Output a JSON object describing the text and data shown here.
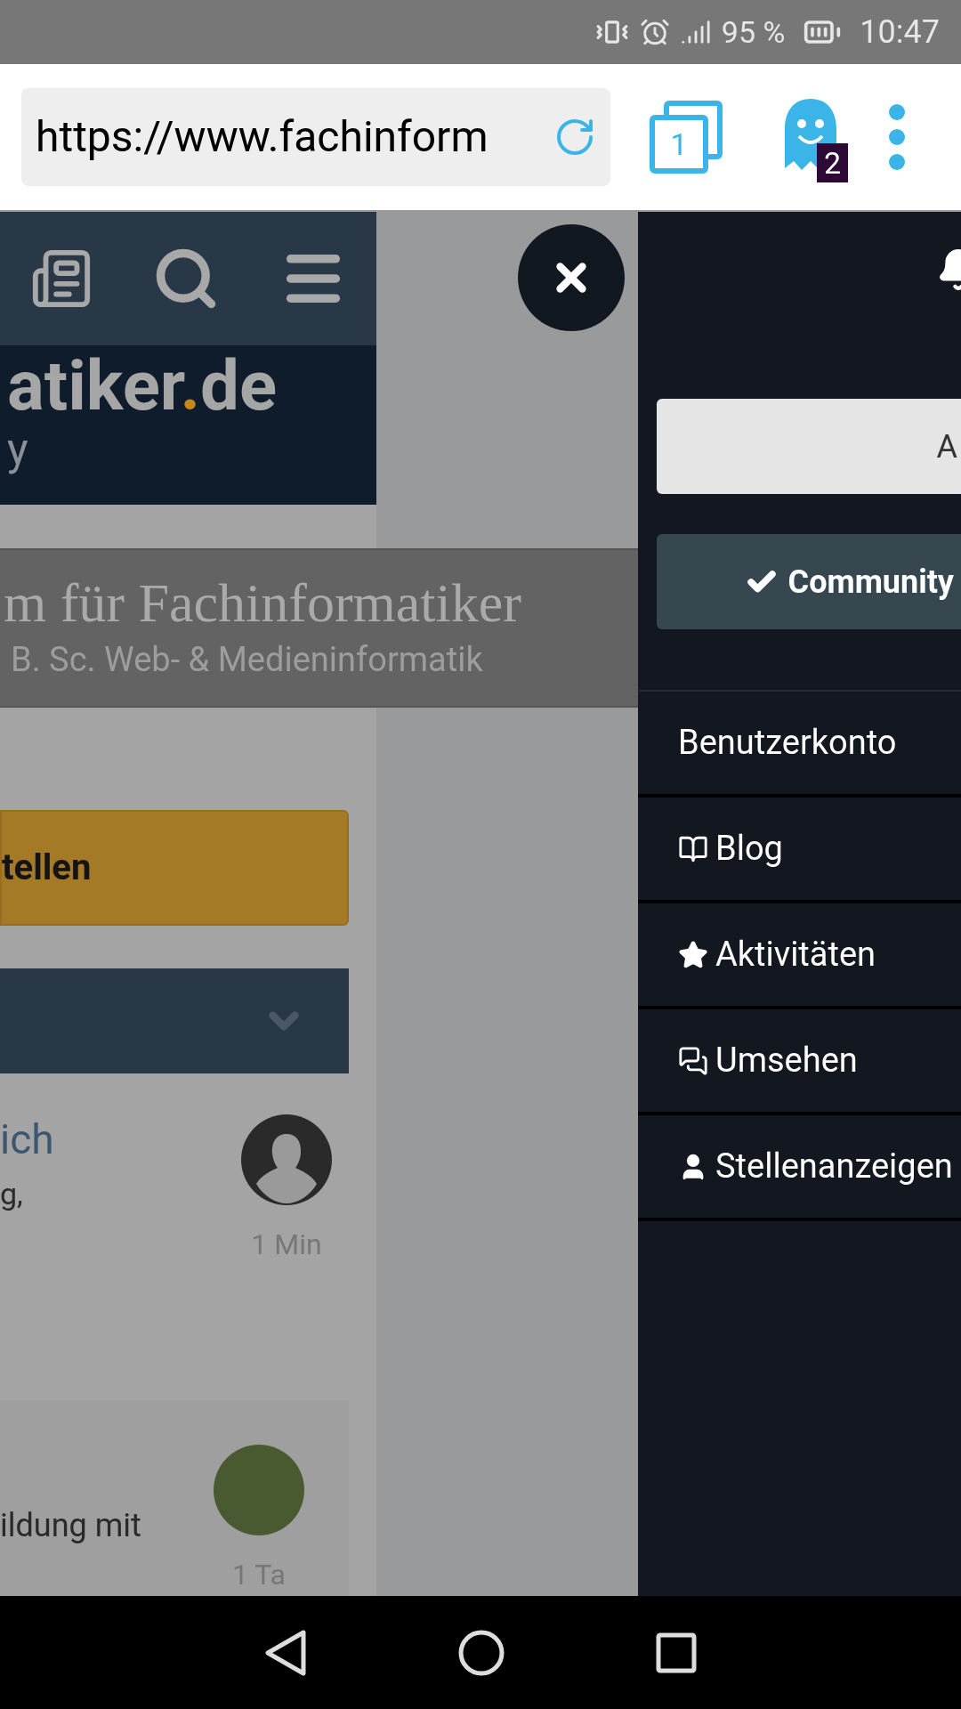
{
  "status_bar": {
    "battery": "95 %",
    "time": "10:47"
  },
  "browser": {
    "url": "https://www.fachinform",
    "tab_count": "1",
    "ghost_badge": "2"
  },
  "page": {
    "logo": {
      "name": "atiker",
      "dot": ".",
      "tld": "de",
      "tagline": "y"
    },
    "banner": {
      "title": "m für Fachinformatiker",
      "subtitle": "B. Sc. Web- & Medieninformatik"
    },
    "cta": "tellen",
    "posts": [
      {
        "title": "ich",
        "excerpt": "g,",
        "time": "1 Min",
        "kind": "silhouette"
      },
      {
        "excerpt": "ildung mit",
        "time": "1 Ta",
        "kind": "photo"
      }
    ]
  },
  "drawer": {
    "buttons": [
      {
        "label": "A",
        "selected": false
      },
      {
        "label": "Community",
        "selected": true
      }
    ],
    "items": [
      {
        "label": "Benutzerkonto",
        "kind": "plain"
      },
      {
        "label": "Blog",
        "kind": "book"
      },
      {
        "label": "Aktivitäten",
        "kind": "star"
      },
      {
        "label": "Umsehen",
        "kind": "chat"
      },
      {
        "label": "Stellenanzeigen",
        "kind": "person"
      }
    ]
  }
}
